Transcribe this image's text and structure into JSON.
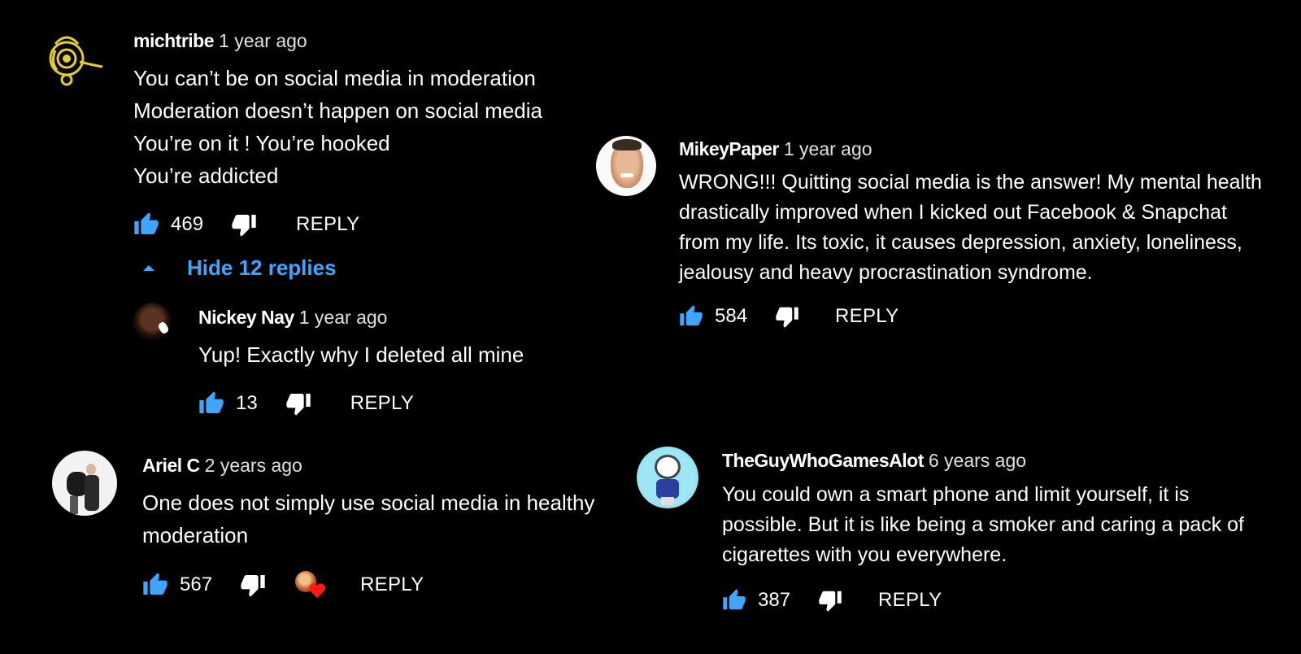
{
  "colors": {
    "background": "#000000",
    "accent": "#3ea6ff",
    "text": "#ffffff",
    "heart": "#ff1a1a"
  },
  "comments": {
    "michtribe": {
      "author": "michtribe",
      "time": "1 year ago",
      "lines": [
        "You can’t be on social media in moderation",
        "Moderation doesn’t happen on social media",
        "You’re on it ! You’re hooked",
        "You’re addicted"
      ],
      "likes": "469",
      "reply_label": "REPLY",
      "avatar_icon": "gold-emblem-icon"
    },
    "replies_toggle": {
      "label": "Hide 12 replies",
      "icon": "chevron-up-icon"
    },
    "nickey": {
      "author": "Nickey Nay",
      "time": "1 year ago",
      "lines": [
        "Yup! Exactly why I deleted all mine"
      ],
      "likes": "13",
      "reply_label": "REPLY"
    },
    "ariel": {
      "author": "Ariel C",
      "time": "2 years ago",
      "lines": [
        "One does not simply use social media in healthy",
        "moderation"
      ],
      "likes": "567",
      "reply_label": "REPLY",
      "hearted_icon": "creator-heart-icon"
    },
    "mikey": {
      "author": "MikeyPaper",
      "time": "1 year ago",
      "lines": [
        "WRONG!!! Quitting social media is the answer! My mental health",
        "drastically improved when I kicked out Facebook & Snapchat",
        "from my life. Its toxic, it causes depression, anxiety, loneliness,",
        "jealousy and heavy procrastination syndrome."
      ],
      "likes": "584",
      "reply_label": "REPLY"
    },
    "theguy": {
      "author": "TheGuyWhoGamesAlot",
      "time": "6 years ago",
      "lines": [
        "You could own a smart phone and limit yourself, it is",
        "possible. But it is like being a smoker and caring a pack of",
        "cigarettes with you everywhere."
      ],
      "likes": "387",
      "reply_label": "REPLY"
    }
  }
}
